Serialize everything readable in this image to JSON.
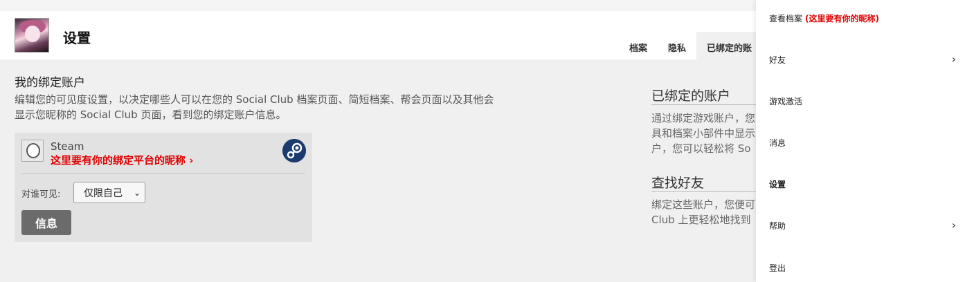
{
  "header": {
    "title": "设置"
  },
  "tabs": [
    {
      "label": "档案"
    },
    {
      "label": "隐私"
    },
    {
      "label": "已绑定的账"
    }
  ],
  "main": {
    "title": "我的绑定账户",
    "description": "编辑您的可见度设置，以决定哪些人可以在您的 Social Club 档案页面、简短档案、帮会页面以及其他会显示您昵称的 Social Club 页面，看到您的绑定账户信息。"
  },
  "account_card": {
    "platform": "Steam",
    "nickname": "这里要有你的绑定平台的昵称",
    "visibility_label": "对谁可见:",
    "visibility_value": "仅限自己",
    "info_button": "信息"
  },
  "sidebar_info": {
    "linked_title": "已绑定的账户",
    "linked_lines": [
      "通过绑定游戏账户，您",
      "具和档案小部件中显示",
      "户，您可以轻松将 So"
    ],
    "friends_title": "查找好友",
    "friends_lines": [
      "绑定这些账户，您便可",
      "Club 上更轻松地找到"
    ]
  },
  "menu": {
    "view_profile": "查看档案",
    "view_profile_note": "(这里要有你的昵称)",
    "friends": "好友",
    "game_activation": "游戏激活",
    "messages": "消息",
    "settings": "设置",
    "help": "帮助",
    "logout": "登出"
  },
  "colors": {
    "accent_red": "#e00000",
    "steam_blue": "#1b3b6f",
    "button_gray": "#6b6b6b"
  }
}
